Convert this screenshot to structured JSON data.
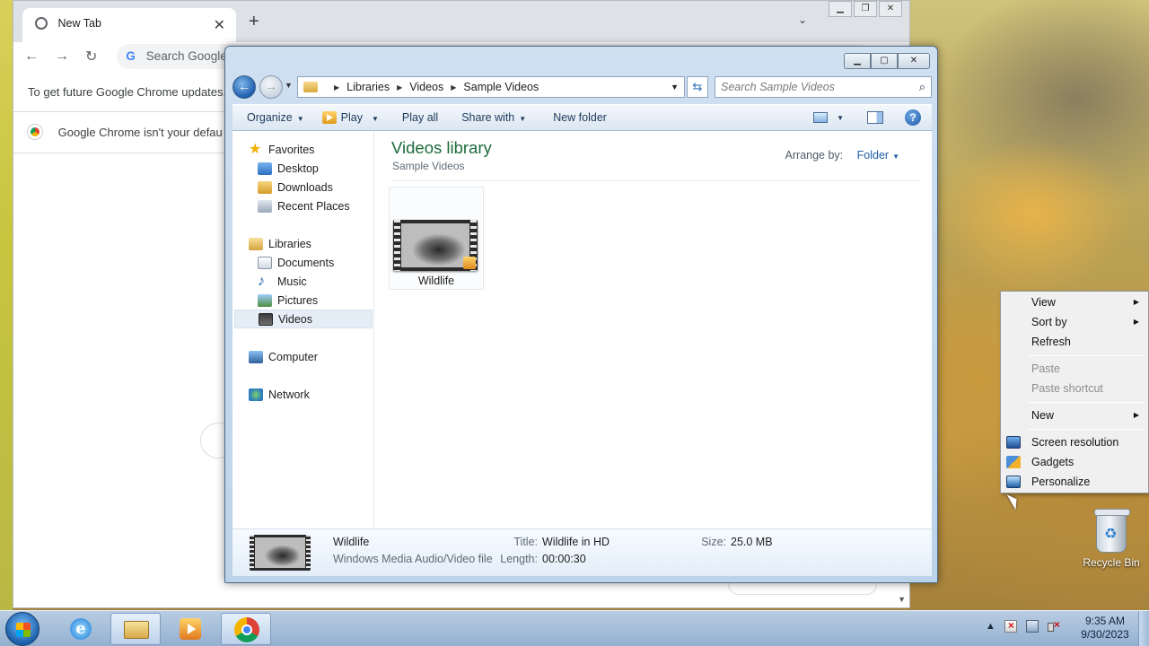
{
  "chrome": {
    "tab_title": "New Tab",
    "omnibox_placeholder": "Search Google",
    "update_notice": "To get future Google Chrome updates,",
    "default_notice": "Google Chrome isn't your defau"
  },
  "explorer": {
    "breadcrumb": [
      "Libraries",
      "Videos",
      "Sample Videos"
    ],
    "search_placeholder": "Search Sample Videos",
    "commands": {
      "organize": "Organize",
      "play": "Play",
      "play_all": "Play all",
      "share_with": "Share with",
      "new_folder": "New folder"
    },
    "nav": {
      "favorites": "Favorites",
      "desktop": "Desktop",
      "downloads": "Downloads",
      "recent_places": "Recent Places",
      "libraries": "Libraries",
      "documents": "Documents",
      "music": "Music",
      "pictures": "Pictures",
      "videos": "Videos",
      "computer": "Computer",
      "network": "Network"
    },
    "library_title": "Videos library",
    "library_subtitle": "Sample Videos",
    "arrange_by_label": "Arrange by:",
    "arrange_by_value": "Folder",
    "files": [
      {
        "name": "Wildlife"
      }
    ],
    "details": {
      "name": "Wildlife",
      "type": "Windows Media Audio/Video file",
      "title_label": "Title:",
      "title_value": "Wildlife in HD",
      "length_label": "Length:",
      "length_value": "00:00:30",
      "size_label": "Size:",
      "size_value": "25.0 MB"
    }
  },
  "context_menu": {
    "view": "View",
    "sort_by": "Sort by",
    "refresh": "Refresh",
    "paste": "Paste",
    "paste_shortcut": "Paste shortcut",
    "new": "New",
    "screen_resolution": "Screen resolution",
    "gadgets": "Gadgets",
    "personalize": "Personalize"
  },
  "desktop": {
    "recycle_bin": "Recycle Bin"
  },
  "taskbar": {
    "time": "9:35 AM",
    "date": "9/30/2023"
  }
}
